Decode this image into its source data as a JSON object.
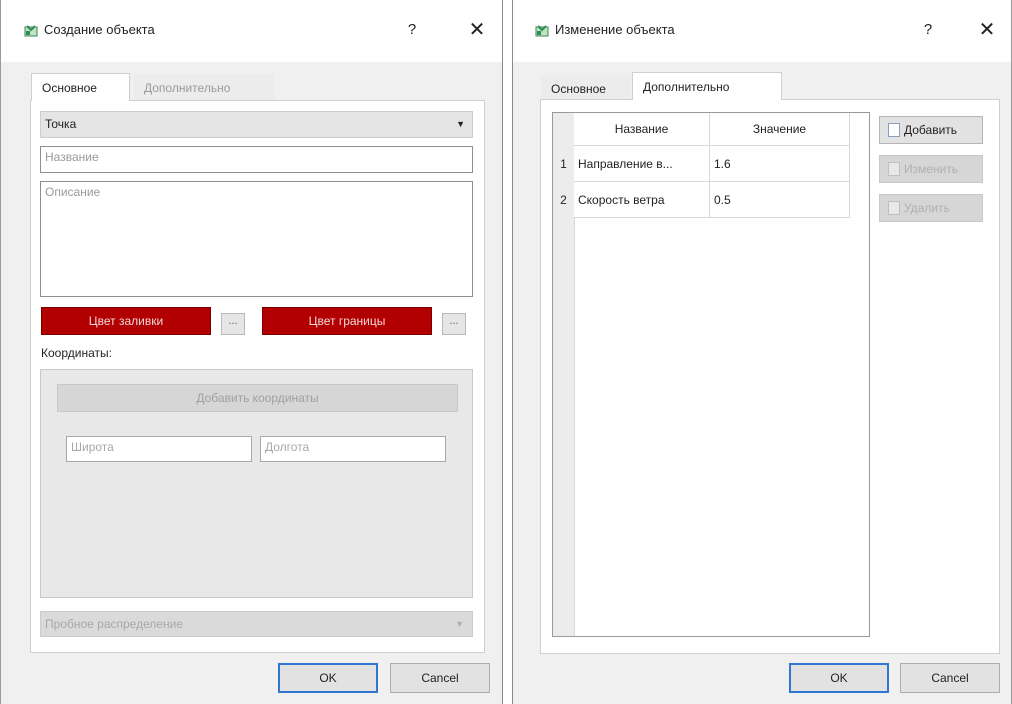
{
  "dialog_create": {
    "title": "Создание объекта",
    "help": "?",
    "close": "✕",
    "tabs": [
      {
        "label": "Основное",
        "active": true
      },
      {
        "label": "Дополнительно",
        "active": false
      }
    ],
    "type_select": {
      "value": "Точка"
    },
    "name_field": {
      "placeholder": "Название"
    },
    "description_field": {
      "placeholder": "Описание"
    },
    "fill_color_button": "Цвет заливки",
    "border_color_button": "Цвет границы",
    "dots_button": "...",
    "coordinates_label": "Координаты:",
    "add_coordinates_button": "Добавить координаты",
    "latitude_field": {
      "placeholder": "Широта"
    },
    "longitude_field": {
      "placeholder": "Долгота"
    },
    "distribution_select": {
      "value": "Пробное распределение"
    },
    "ok_button": "OK",
    "cancel_button": "Cancel"
  },
  "dialog_edit": {
    "title": "Изменение объекта",
    "help": "?",
    "close": "✕",
    "tabs": [
      {
        "label": "Основное",
        "active": false
      },
      {
        "label": "Дополнительно",
        "active": true
      }
    ],
    "table": {
      "columns": [
        "Название",
        "Значение"
      ],
      "rows": [
        {
          "num": "1",
          "name": "Направление в...",
          "value": "1.6"
        },
        {
          "num": "2",
          "name": "Скорость ветра",
          "value": "0.5"
        }
      ]
    },
    "add_button": "Добавить",
    "edit_button": "Изменить",
    "delete_button": "Удалить",
    "ok_button": "OK",
    "cancel_button": "Cancel"
  },
  "colors": {
    "accent_red": "#b20000",
    "default_button_border": "#2f77d1",
    "icon_green": "#2e8b57"
  },
  "icons": {
    "title_icon": "map-object-icon",
    "dropdown": "chevron-down-icon",
    "add": "add-document-icon",
    "edit": "edit-document-icon",
    "delete": "delete-document-icon"
  }
}
